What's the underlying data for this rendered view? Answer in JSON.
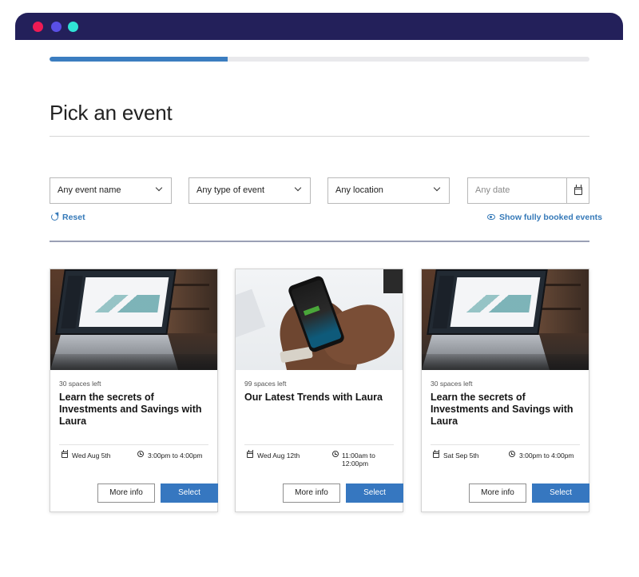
{
  "progress": {
    "fraction": 0.33
  },
  "page": {
    "title": "Pick an event"
  },
  "filters": {
    "event_name": "Any event name",
    "event_type": "Any type of event",
    "location": "Any location",
    "date_placeholder": "Any date",
    "reset_label": "Reset",
    "show_booked_label": "Show fully booked events"
  },
  "events": [
    {
      "spaces": "30 spaces left",
      "title": "Learn the secrets of Investments and Savings with Laura",
      "date": "Wed Aug 5th",
      "time": "3:00pm to 4:00pm",
      "more_label": "More info",
      "select_label": "Select"
    },
    {
      "spaces": "99 spaces left",
      "title": "Our Latest Trends with Laura",
      "date": "Wed Aug 12th",
      "time": "11:00am to 12:00pm",
      "more_label": "More info",
      "select_label": "Select"
    },
    {
      "spaces": "30 spaces left",
      "title": "Learn the secrets of Investments and Savings with Laura",
      "date": "Sat Sep 5th",
      "time": "3:00pm to 4:00pm",
      "more_label": "More info",
      "select_label": "Select"
    }
  ],
  "icons": {
    "window_controls": [
      "red-dot",
      "purple-dot",
      "cyan-dot"
    ],
    "reset": "refresh-icon",
    "show_booked": "eye-icon",
    "date": "calendar-icon",
    "time": "clock-icon"
  },
  "colors": {
    "titlebar": "#23205a",
    "accent": "#3677c0",
    "link": "#3579b8",
    "progress_fill": "#3b7dc0"
  }
}
